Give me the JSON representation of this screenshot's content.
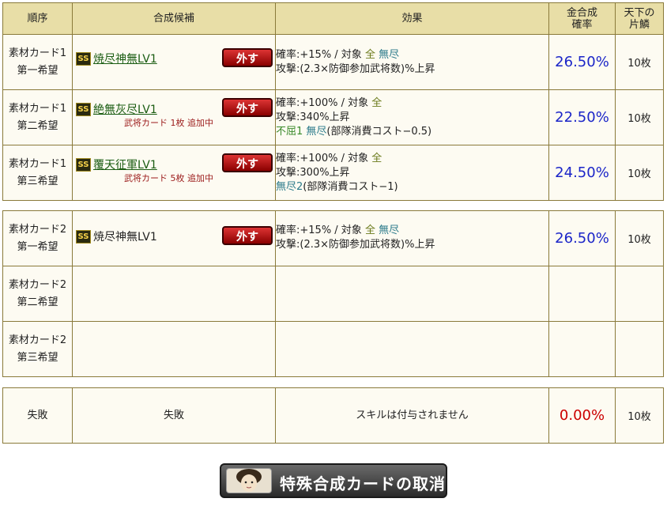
{
  "headers": {
    "order": "順序",
    "candidate": "合成候補",
    "effect": "効果",
    "rate_line1": "金合成",
    "rate_line2": "確率",
    "scale_line1": "天下の",
    "scale_line2": "片鱗"
  },
  "group1": [
    {
      "order_line1": "素材カード1",
      "order_line2": "第一希望",
      "rarity": "SS",
      "name": "焼尽神無LV1",
      "remove_label": "外す",
      "note": "",
      "effect_line1": {
        "a": "確率:+15% / 対象 ",
        "b": "全",
        "c": " ",
        "d": "無尽"
      },
      "effect_line2": "攻撃:(2.3×防御参加武将数)%上昇",
      "effect_line3": {
        "a": "",
        "b": "",
        "c": ""
      },
      "rate": "26.50%",
      "scale": "10枚"
    },
    {
      "order_line1": "素材カード1",
      "order_line2": "第二希望",
      "rarity": "SS",
      "name": "絶無灰尽LV1",
      "remove_label": "外す",
      "note": "武将カード 1枚 追加中",
      "effect_line1": {
        "a": "確率:+100% / 対象 ",
        "b": "全",
        "c": "",
        "d": ""
      },
      "effect_line2": "攻撃:340%上昇",
      "effect_line3": {
        "a": "不屈1",
        "b": " 無尽",
        "c": "(部隊消費コスト−0.5)"
      },
      "rate": "22.50%",
      "scale": "10枚"
    },
    {
      "order_line1": "素材カード1",
      "order_line2": "第三希望",
      "rarity": "SS",
      "name": "覆天征軍LV1",
      "remove_label": "外す",
      "note": "武将カード 5枚 追加中",
      "effect_line1": {
        "a": "確率:+100% / 対象 ",
        "b": "全",
        "c": "",
        "d": ""
      },
      "effect_line2": "攻撃:300%上昇",
      "effect_line3": {
        "a": "",
        "b": "無尽2",
        "c": "(部隊消費コスト−1)"
      },
      "rate": "24.50%",
      "scale": "10枚"
    }
  ],
  "group2": [
    {
      "order_line1": "素材カード2",
      "order_line2": "第一希望",
      "rarity": "SS",
      "name": "焼尽神無LV1",
      "remove_label": "外す",
      "effect_line1": {
        "a": "確率:+15% / 対象 ",
        "b": "全",
        "c": " ",
        "d": "無尽"
      },
      "effect_line2": "攻撃:(2.3×防御参加武将数)%上昇",
      "rate": "26.50%",
      "scale": "10枚"
    },
    {
      "order_line1": "素材カード2",
      "order_line2": "第二希望"
    },
    {
      "order_line1": "素材カード2",
      "order_line2": "第三希望"
    }
  ],
  "failure": {
    "order": "失敗",
    "candidate": "失敗",
    "effect": "スキルは付与されません",
    "rate": "0.00%",
    "scale": "10枚"
  },
  "cancel_button": "特殊合成カードの取消",
  "colors": {
    "header_bg": "#e8dea7",
    "border": "#8a7a3a",
    "rate_blue": "#1b25c8",
    "rate_red": "#cc0000",
    "link_green": "#1a5c12"
  }
}
